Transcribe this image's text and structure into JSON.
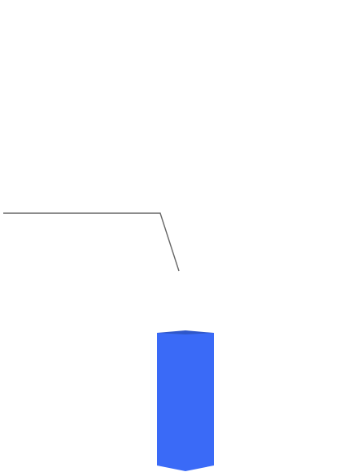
{
  "canvas": {
    "background": "#ffffff"
  },
  "leader_line": {
    "color": "#666666"
  },
  "column_shape": {
    "face_color": "#3a6af7",
    "top_color": "#2f57c9"
  }
}
